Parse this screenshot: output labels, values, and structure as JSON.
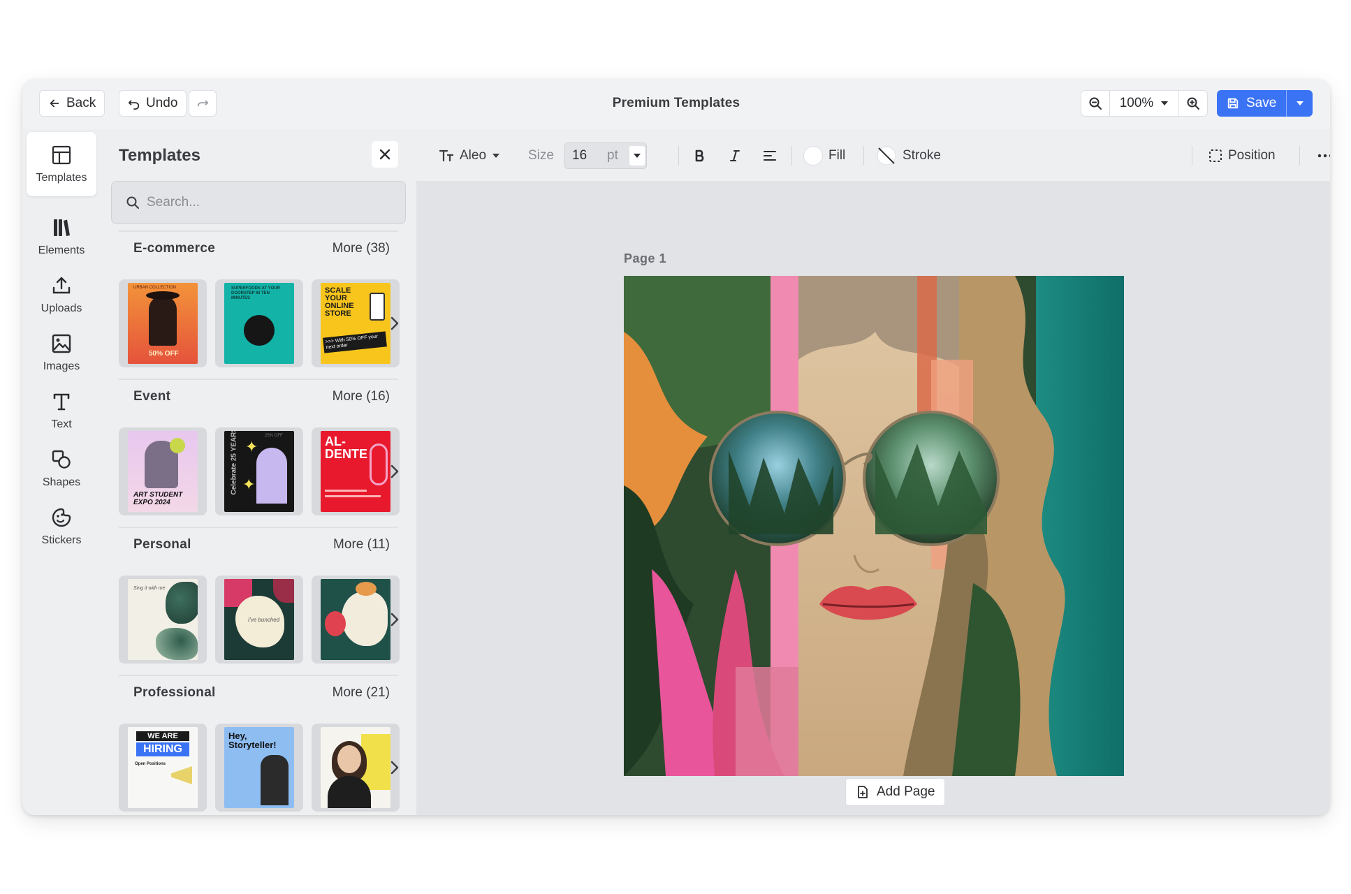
{
  "header": {
    "back_label": "Back",
    "undo_label": "Undo",
    "title": "Premium Templates",
    "zoom_value": "100%",
    "save_label": "Save"
  },
  "rail": {
    "items": [
      {
        "label": "Templates",
        "icon": "layout-icon"
      },
      {
        "label": "Elements",
        "icon": "elements-icon"
      },
      {
        "label": "Uploads",
        "icon": "upload-icon"
      },
      {
        "label": "Images",
        "icon": "image-icon"
      },
      {
        "label": "Text",
        "icon": "text-icon"
      },
      {
        "label": "Shapes",
        "icon": "shapes-icon"
      },
      {
        "label": "Stickers",
        "icon": "sticker-icon"
      }
    ]
  },
  "panel": {
    "title": "Templates",
    "search_placeholder": "Search...",
    "sections": [
      {
        "name": "E-commerce",
        "more": "More (38)"
      },
      {
        "name": "Event",
        "more": "More (16)"
      },
      {
        "name": "Personal",
        "more": "More (11)"
      },
      {
        "name": "Professional",
        "more": "More (21)"
      }
    ],
    "thumb_text": {
      "ecom_1_top": "URBAN COLLECTION",
      "ecom_1_bottom": "50% OFF",
      "ecom_2": "SUPERFOODS AT YOUR DOORSTEP IN TEN MINUTES",
      "ecom_3_a": "SCALE YOUR ONLINE STORE",
      "ecom_3_b": ">>> With 50% OFF your next order",
      "event_1": "ART STUDENT EXPO 2024",
      "event_2": "Celebrate 25 YEARS",
      "event_2_corner": "25% OFF",
      "event_3": "AL- DENTE",
      "personal_1": "Sing it with me",
      "personal_2": "I've bunched",
      "prof_1_a": "WE ARE",
      "prof_1_b": "HIRING",
      "prof_1_c": "Open Positions",
      "prof_2": "Hey, Storyteller!"
    }
  },
  "toolbar": {
    "font": "Aleo",
    "size_label": "Size",
    "size_value": "16",
    "size_unit": "pt",
    "fill_label": "Fill",
    "stroke_label": "Stroke",
    "position_label": "Position"
  },
  "canvas": {
    "page_label": "Page  1",
    "add_page_label": "Add Page"
  },
  "colors": {
    "accent": "#3b73f5",
    "panel_bg": "#eeeff1",
    "stage_bg": "#e1e3e6"
  }
}
